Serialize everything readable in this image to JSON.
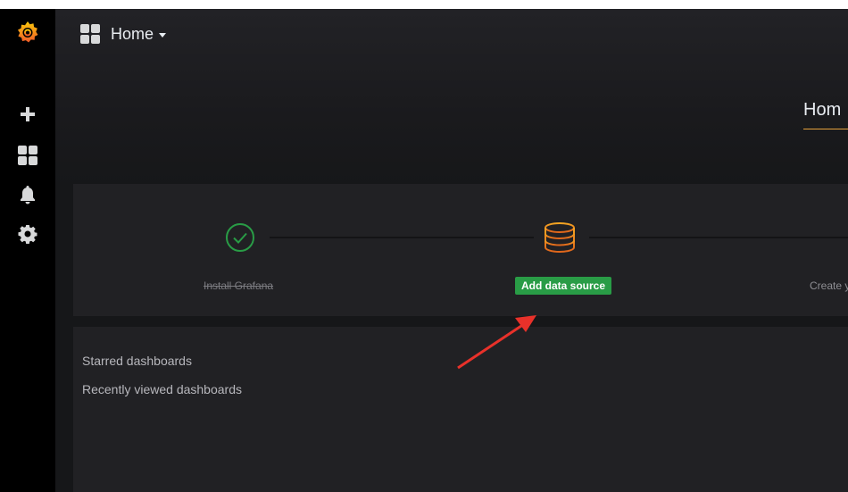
{
  "sidebar": {
    "items": [
      {
        "icon": "grafana-logo-icon"
      },
      {
        "icon": "plus-icon"
      },
      {
        "icon": "dashboards-icon"
      },
      {
        "icon": "bell-icon"
      },
      {
        "icon": "gear-icon"
      }
    ]
  },
  "topbar": {
    "title": "Home"
  },
  "home_tab": {
    "label": "Hom"
  },
  "onboarding": {
    "steps": [
      {
        "label": "Install Grafana",
        "status": "done",
        "icon": "check-circle-icon"
      },
      {
        "label": "Add data source",
        "status": "active",
        "icon": "database-icon"
      },
      {
        "label": "Create y",
        "status": "pending"
      }
    ]
  },
  "dashboards": {
    "starred_label": "Starred dashboards",
    "recent_label": "Recently viewed dashboards"
  },
  "colors": {
    "accent": "#e6a23c",
    "success": "#299c46",
    "sidebar_bg": "#000000",
    "panel_bg": "#212124",
    "annotation_arrow": "#e8312a"
  }
}
